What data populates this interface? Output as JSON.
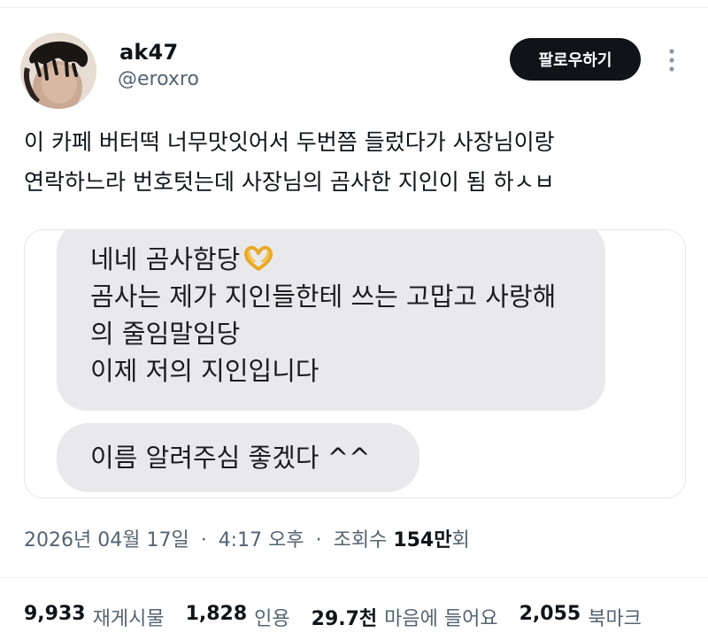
{
  "user": {
    "display_name": "ak47",
    "handle": "@eroxro"
  },
  "follow_button_label": "팔로우하기",
  "icons": {
    "more": "more-vertical-icon",
    "avatar": "user-avatar",
    "emoji": "heart-hands-emoji"
  },
  "tweet": {
    "lines": [
      "이 카페 버터떡 너무맛잇어서 두번쯤 들렀다가 사장님이랑",
      "연락하느라 번호텃는데 사장님의 곰사한 지인이 됨 하ㅅㅂ"
    ]
  },
  "chat": {
    "bubble1_lines": [
      "네네 곰사함당",
      "곰사는 제가 지인들한테 쓰는 고맙고 사랑해",
      "의 줄임말임당",
      "이제 저의 지인입니다"
    ],
    "bubble2": "이름 알려주심 좋겠다 ^^"
  },
  "meta": {
    "date": "2026년 04월 17일",
    "time": "4:17 오후",
    "views_prefix": "조회수",
    "views_count": "154만",
    "views_suffix": "회",
    "separator": "·"
  },
  "stats": [
    {
      "count": "9,933",
      "label": "재게시물"
    },
    {
      "count": "1,828",
      "label": "인용"
    },
    {
      "count": "29.7천",
      "label": "마음에 들어요"
    },
    {
      "count": "2,055",
      "label": "북마크"
    }
  ],
  "colors": {
    "follow_bg": "#0f1419",
    "secondary_text": "#536471",
    "bubble_bg": "#e9e9eb"
  }
}
